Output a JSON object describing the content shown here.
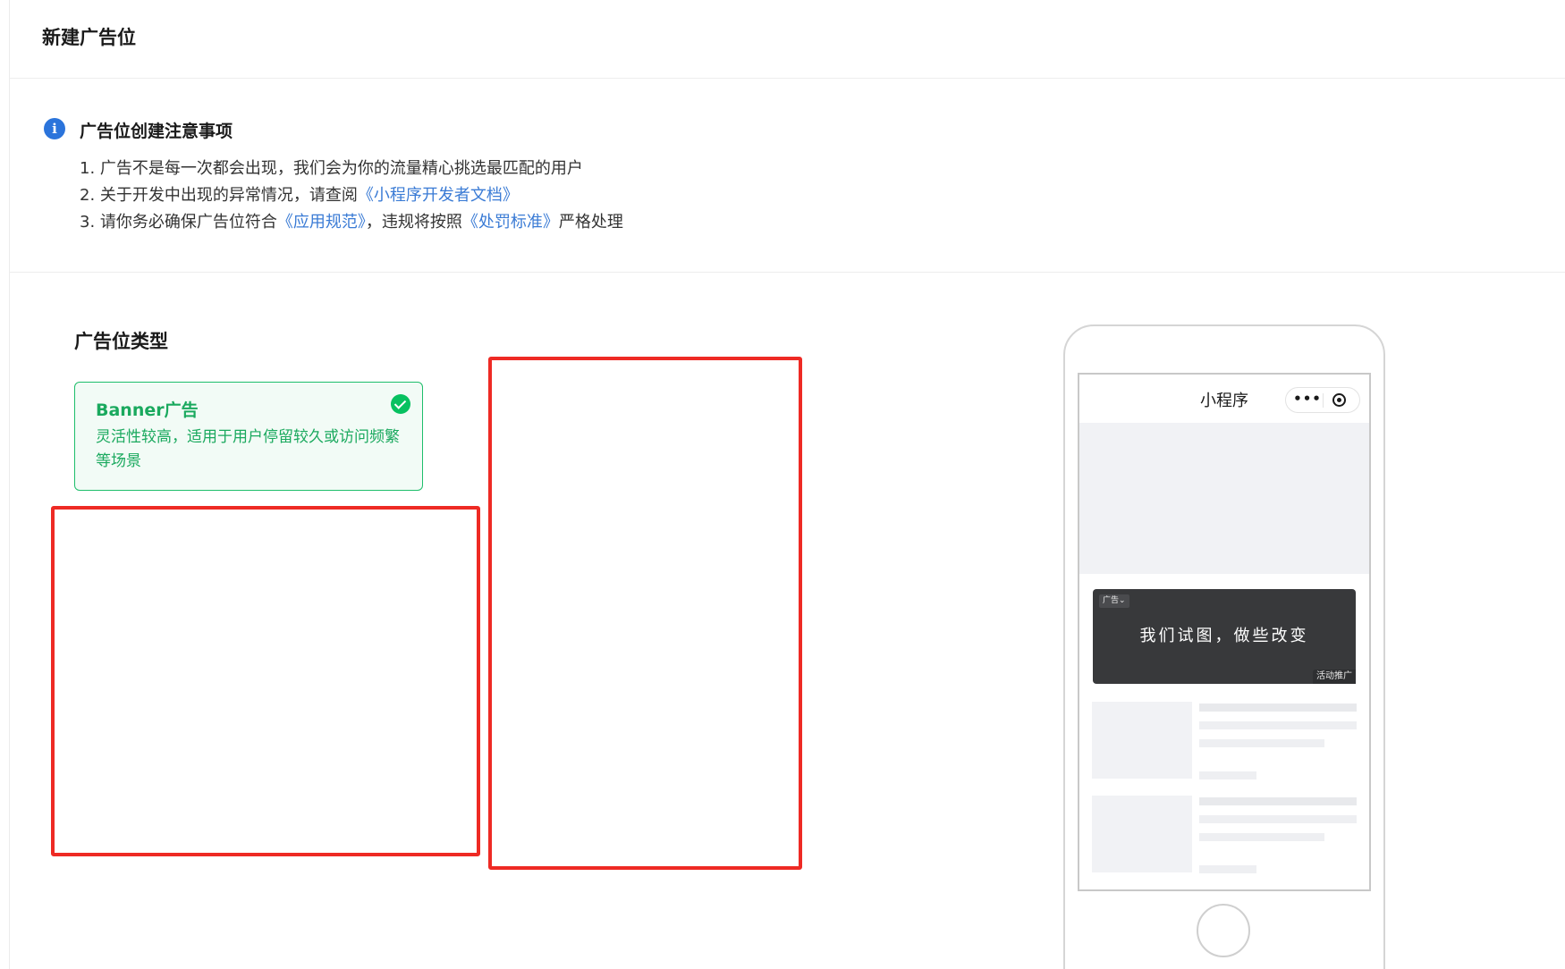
{
  "header": {
    "title": "新建广告位"
  },
  "notice": {
    "icon": "info-icon",
    "icon_glyph": "i",
    "title": "广告位创建注意事项",
    "item1": "1. 广告不是每一次都会出现，我们会为你的流量精心挑选最匹配的用户",
    "item2_prefix": "2. 关于开发中出现的异常情况，请查阅",
    "item2_link": "《小程序开发者文档》",
    "item3_prefix": "3. 请你务必确保广告位符合",
    "item3_link1": "《应用规范》",
    "item3_middle": "，违规将按照",
    "item3_link2": "《处罚标准》",
    "item3_suffix": "严格处理",
    "link_color": "#3a7bd5"
  },
  "ad_type": {
    "section_title": "广告位类型",
    "selected_card": {
      "title": "Banner广告",
      "description": "灵活性较高，适用于用户停留较久或访问频繁等场景",
      "selected": true,
      "accent_color": "#07c160"
    }
  },
  "preview": {
    "nav_title": "小程序",
    "capsule_more_glyph": "•••",
    "banner": {
      "tag": "广告⌄",
      "slogan": "我们试图，做些改变",
      "badge": "活动推广"
    }
  },
  "annotation_color": "#ee2a24"
}
